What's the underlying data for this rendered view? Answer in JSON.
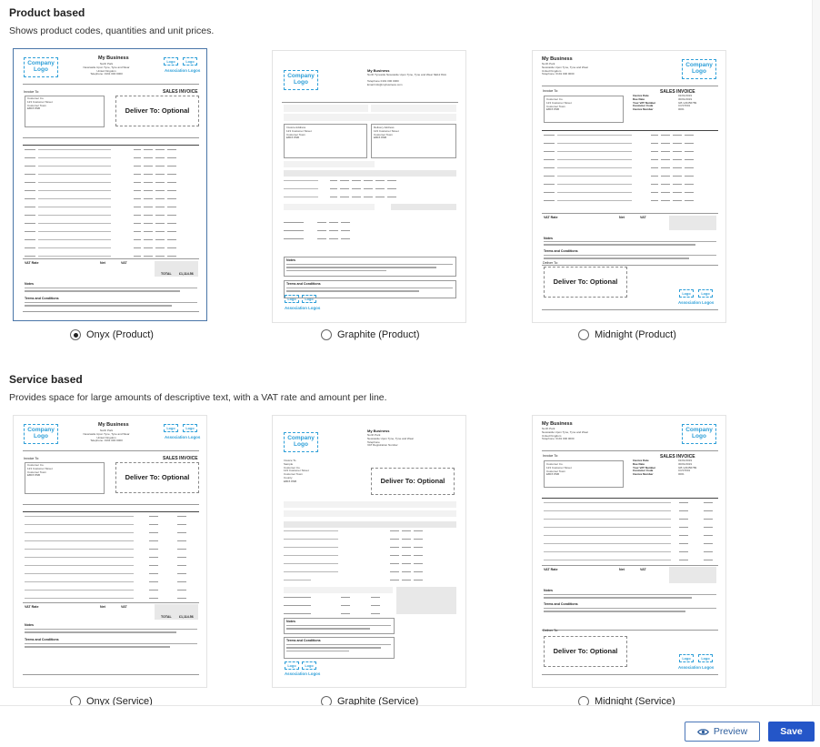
{
  "sections": {
    "product": {
      "title": "Product based",
      "description": "Shows product codes, quantities and unit prices."
    },
    "service": {
      "title": "Service based",
      "description": "Provides space for large amounts of descriptive text, with a VAT rate and amount per line."
    }
  },
  "templates": {
    "product": [
      {
        "label": "Onyx (Product)",
        "selected": true
      },
      {
        "label": "Graphite (Product)",
        "selected": false
      },
      {
        "label": "Midnight (Product)",
        "selected": false
      }
    ],
    "service": [
      {
        "label": "Onyx (Service)",
        "selected": false
      },
      {
        "label": "Graphite (Service)",
        "selected": false
      },
      {
        "label": "Midnight (Service)",
        "selected": false
      }
    ]
  },
  "preview_doc": {
    "business_name": "My Business",
    "company_logo": "Company Logo",
    "logo_small": "Logo",
    "association_logos": "Association Logos",
    "sales_invoice": "SALES INVOICE",
    "deliver_to": "Deliver To: Optional",
    "invoice_to": "Invoice To:",
    "deliver_to_label": "Deliver To:",
    "vat_rate": "VAT Rate",
    "net": "Net",
    "vat": "VAT",
    "total": "TOTAL",
    "notes": "Notes",
    "terms": "Terms and Conditions",
    "product_code": "PRD0001",
    "total_amount": "£1,114.56"
  },
  "footer": {
    "preview_label": "Preview",
    "save_label": "Save"
  },
  "colors": {
    "accent": "#2456c8",
    "logo_blue": "#2e9fd8",
    "selected_border": "#4a76a8"
  }
}
